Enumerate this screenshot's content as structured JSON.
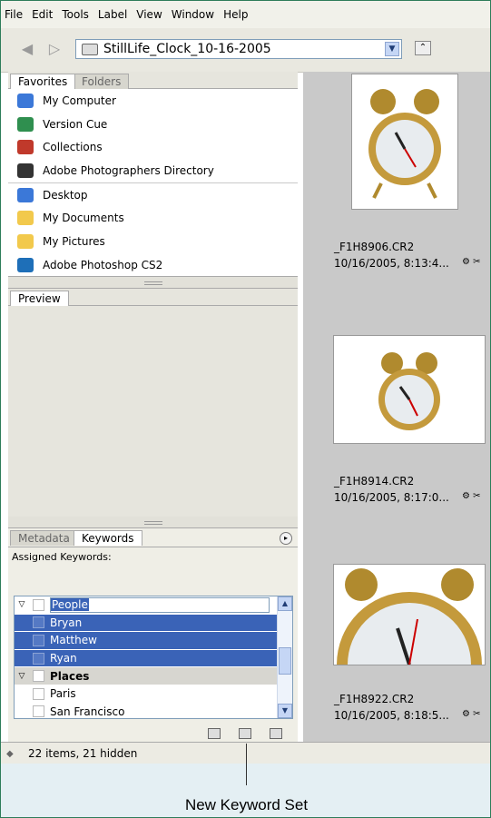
{
  "menu": [
    "File",
    "Edit",
    "Tools",
    "Label",
    "View",
    "Window",
    "Help"
  ],
  "toolbar": {
    "path": "StillLife_Clock_10-16-2005"
  },
  "left_panel": {
    "tabs": [
      "Favorites",
      "Folders"
    ],
    "favorites": [
      {
        "label": "My Computer",
        "icon": "computer-icon",
        "color": "#3b78d8"
      },
      {
        "label": "Version Cue",
        "icon": "version-cue-icon",
        "color": "#2f8f4f"
      },
      {
        "label": "Collections",
        "icon": "collections-icon",
        "color": "#c0392b"
      },
      {
        "label": "Adobe Photographers Directory",
        "icon": "camera-tripod-icon",
        "color": "#333333"
      },
      {
        "label": "Desktop",
        "icon": "desktop-icon",
        "color": "#3b78d8"
      },
      {
        "label": "My Documents",
        "icon": "folder-icon",
        "color": "#f2c94c"
      },
      {
        "label": "My Pictures",
        "icon": "pictures-folder-icon",
        "color": "#f2c94c"
      },
      {
        "label": "Adobe Photoshop CS2",
        "icon": "photoshop-feather-icon",
        "color": "#1e6fb8"
      }
    ],
    "preview_tab": "Preview",
    "keyword_tabs": [
      "Metadata",
      "Keywords"
    ],
    "assigned_label": "Assigned Keywords:",
    "keywords": [
      {
        "label": "People",
        "type": "group-edit"
      },
      {
        "label": "Bryan",
        "type": "selected"
      },
      {
        "label": "Matthew",
        "type": "selected"
      },
      {
        "label": "Ryan",
        "type": "selected"
      },
      {
        "label": "Places",
        "type": "group"
      },
      {
        "label": "Paris",
        "type": "normal"
      },
      {
        "label": "San Francisco",
        "type": "normal"
      }
    ]
  },
  "thumbnails": [
    {
      "name": "_F1H8906.CR2",
      "date": "10/16/2005, 8:13:4..."
    },
    {
      "name": "_F1H8914.CR2",
      "date": "10/16/2005, 8:17:0..."
    },
    {
      "name": "_F1H8922.CR2",
      "date": "10/16/2005, 8:18:5..."
    }
  ],
  "status": "22 items, 21 hidden",
  "callout": "New Keyword Set"
}
